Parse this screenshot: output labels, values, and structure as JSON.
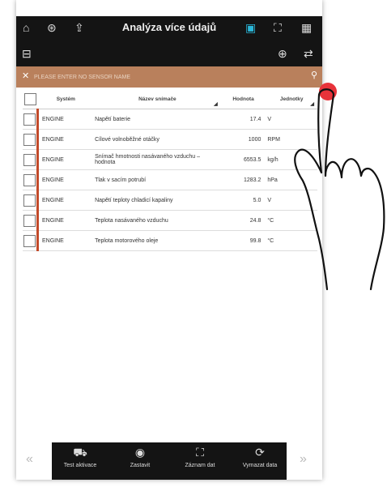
{
  "header": {
    "title": "Analýza více údajů",
    "icons": [
      "home-icon",
      "vehicle-icon",
      "upload-icon",
      "screenshot-icon",
      "fullscreen-icon",
      "grid-icon",
      "graph-icon",
      "live-data-icon",
      "switch-icon"
    ]
  },
  "search": {
    "placeholder": "PLEASE ENTER NO SENSOR NAME"
  },
  "table": {
    "columns": [
      "Systém",
      "Název snímače",
      "Hodnota",
      "Jednotky"
    ],
    "rows": [
      {
        "system": "ENGINE",
        "name": "Napětí baterie",
        "value": "17.4",
        "unit": "V"
      },
      {
        "system": "ENGINE",
        "name": "Cílové volnoběžné otáčky",
        "value": "1000",
        "unit": "RPM"
      },
      {
        "system": "ENGINE",
        "name": "Snímač hmotnosti nasávaného vzduchu – hodnota",
        "value": "6553.5",
        "unit": "kg/h"
      },
      {
        "system": "ENGINE",
        "name": "Tlak v sacím potrubí",
        "value": "1283.2",
        "unit": "hPa"
      },
      {
        "system": "ENGINE",
        "name": "Napětí teploty chladicí kapaliny",
        "value": "5.0",
        "unit": "V"
      },
      {
        "system": "ENGINE",
        "name": "Teplota nasávaného vzduchu",
        "value": "24.8",
        "unit": "°C"
      },
      {
        "system": "ENGINE",
        "name": "Teplota motorového oleje",
        "value": "99.8",
        "unit": "°C"
      }
    ]
  },
  "bottom": {
    "buttons": [
      "Test aktivace",
      "Zastavit",
      "Záznam dat",
      "Vymazat data"
    ]
  },
  "colors": {
    "accent": "#c24a2a",
    "searchbar": "#b9805c",
    "dark": "#141414",
    "touch_dot": "#e8333a"
  }
}
